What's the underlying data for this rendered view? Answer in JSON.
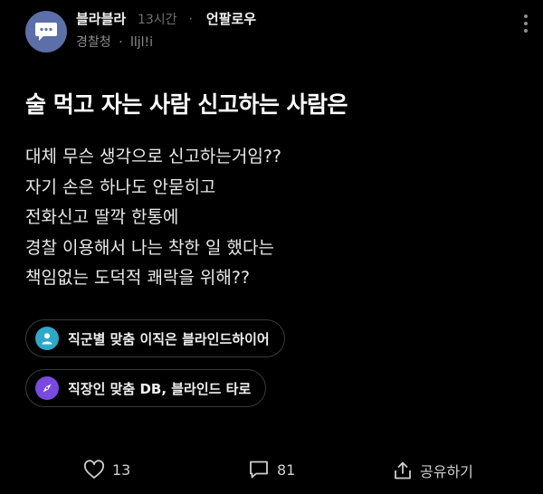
{
  "post": {
    "author": "블라블라",
    "time": "13시간",
    "separator": "·",
    "follow_label": "언팔로우",
    "company": "경찰청",
    "company_sep": "·",
    "nickname": "lljl!i",
    "title": "술 먹고 자는 사람 신고하는 사람은",
    "body_lines": [
      "대체 무슨 생각으로 신고하는거임??",
      "자기 손은 하나도 안묻히고",
      "전화신고 딸깍 한통에",
      "경찰 이용해서 나는 착한 일 했다는",
      "책임없는 도덕적 쾌락을 위해??"
    ]
  },
  "promos": [
    {
      "label": "직군별 맞춤 이직은 블라인드하이어",
      "icon": "person-icon",
      "color": "#2ea8c9"
    },
    {
      "label": "직장인 맞춤 DB, 블라인드 타로",
      "icon": "compass-icon",
      "color": "#7a4ae0"
    }
  ],
  "actions": {
    "like_count": "13",
    "comment_count": "81",
    "share_label": "공유하기"
  },
  "icons": {
    "avatar": "chat-bubble-icon",
    "more": "more-vertical-icon",
    "like": "heart-icon",
    "comment": "comment-icon",
    "share": "share-icon"
  },
  "colors": {
    "background": "#000000",
    "avatar": "#5d6fa8",
    "muted_text": "#8e8e8e"
  }
}
